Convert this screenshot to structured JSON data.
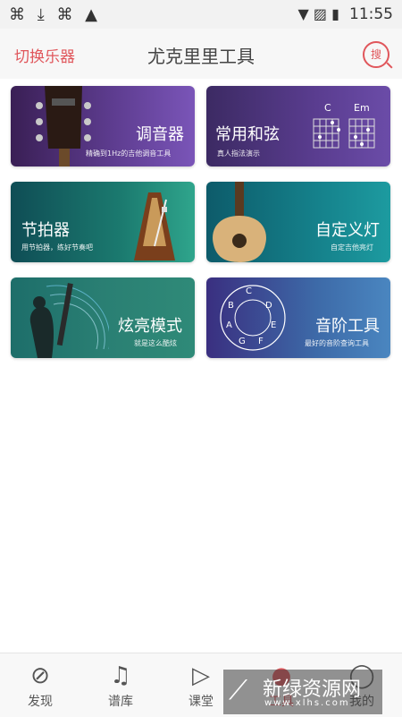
{
  "status_bar": {
    "time": "11:55"
  },
  "header": {
    "switch_instrument": "切换乐器",
    "title": "尤克里里工具",
    "search_label": "搜"
  },
  "cards": [
    {
      "title": "调音器",
      "subtitle": "精确到1Hz的吉他调音工具"
    },
    {
      "title": "常用和弦",
      "subtitle": "真人指法演示",
      "chord_labels": [
        "C",
        "Em"
      ]
    },
    {
      "title": "节拍器",
      "subtitle": "用节拍器，练好节奏吧"
    },
    {
      "title": "自定义灯",
      "subtitle": "自定吉他亮灯"
    },
    {
      "title": "炫亮模式",
      "subtitle": "就是这么酷炫"
    },
    {
      "title": "音阶工具",
      "subtitle": "最好的音阶查询工具",
      "notes": [
        "C",
        "D",
        "E",
        "F",
        "G",
        "A",
        "B"
      ]
    }
  ],
  "tabs": [
    {
      "label": "发现",
      "icon": "compass-icon"
    },
    {
      "label": "谱库",
      "icon": "music-note-icon"
    },
    {
      "label": "课堂",
      "icon": "play-icon"
    },
    {
      "label": "工具",
      "icon": "tools-icon",
      "active": true
    },
    {
      "label": "我的",
      "icon": "person-icon"
    }
  ],
  "watermark": {
    "brand": "新绿资源网",
    "url": "www.xlhs.com"
  },
  "colors": {
    "accent": "#e0565b"
  }
}
